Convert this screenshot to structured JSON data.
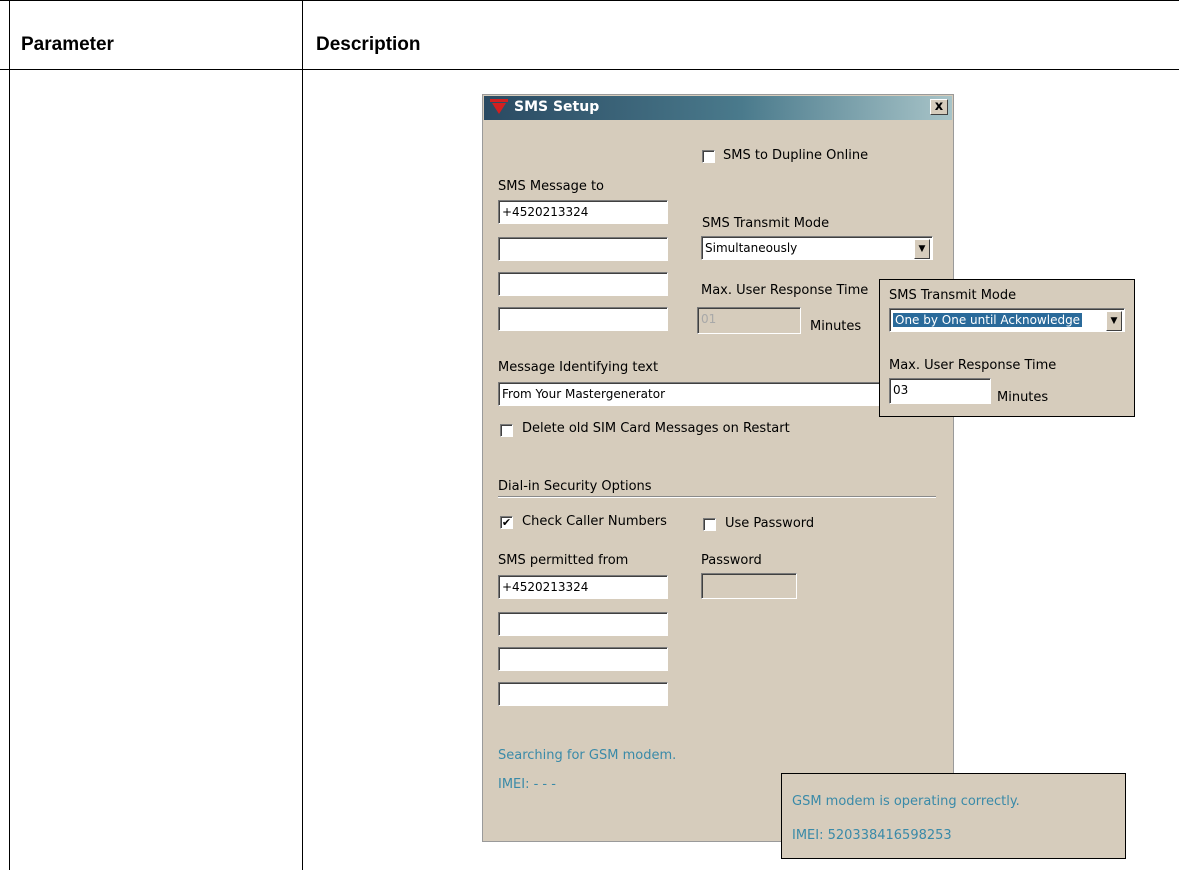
{
  "table": {
    "col1_header": "Parameter",
    "col2_header": "Description"
  },
  "dialog": {
    "title": "SMS Setup",
    "close_label": "x",
    "sms_to_dupline_online": {
      "label": "SMS to Dupline Online",
      "checked": false
    },
    "sms_message_to": {
      "label": "SMS Message to",
      "numbers": [
        "+4520213324",
        "",
        "",
        ""
      ]
    },
    "transmit_mode": {
      "label": "SMS Transmit Mode",
      "value": "Simultaneously"
    },
    "max_response": {
      "label": "Max. User Response Time",
      "value": "01",
      "unit": "Minutes"
    },
    "identifying_text": {
      "label": "Message Identifying text",
      "value": "From Your Mastergenerator"
    },
    "delete_old_sim": {
      "label": "Delete old SIM Card Messages on Restart",
      "checked": false
    },
    "security": {
      "label": "Dial-in Security Options",
      "check_caller": {
        "label": "Check Caller Numbers",
        "checked": true,
        "mark": "✔"
      },
      "use_password": {
        "label": "Use Password",
        "checked": false
      },
      "permitted_label": "SMS permitted from",
      "permitted_numbers": [
        "+4520213324",
        "",
        "",
        ""
      ],
      "password_label": "Password",
      "password_value": ""
    },
    "status": {
      "text": "Searching for GSM modem.",
      "imei": "IMEI: - - -"
    }
  },
  "popup_transmit": {
    "mode_label": "SMS Transmit Mode",
    "mode_value": "One by One until Acknowledge",
    "response_label": "Max. User Response Time",
    "response_value": "03",
    "unit": "Minutes"
  },
  "popup_status": {
    "text": "GSM modem is operating correctly.",
    "imei": "IMEI: 520338416598253"
  },
  "colors": {
    "dialog_bg": "#d6ccbc",
    "status_text": "#3a8aa8",
    "title_gradient_start": "#2a4a62"
  }
}
